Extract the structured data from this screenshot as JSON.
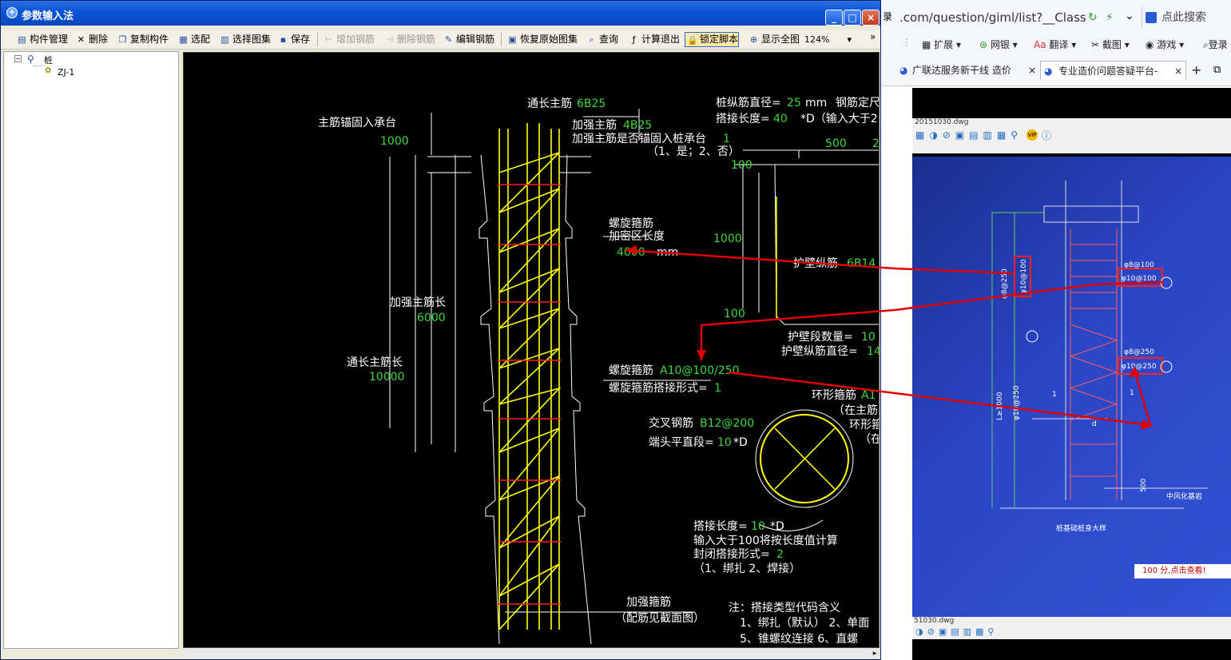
{
  "window": {
    "title": "参数输入法",
    "min_label": "_",
    "max_label": "□",
    "close_label": "×"
  },
  "toolbar": {
    "items": [
      {
        "label": "构件管理",
        "icon": "component-manage-icon",
        "enabled": true
      },
      {
        "label": "删除",
        "icon": "delete-icon",
        "enabled": true
      },
      {
        "label": "复制构件",
        "icon": "copy-icon",
        "enabled": true
      },
      {
        "label": "选配",
        "icon": "select-icon",
        "enabled": true
      },
      {
        "label": "选择图集",
        "icon": "atlas-icon",
        "enabled": true
      },
      {
        "label": "保存",
        "icon": "save-icon",
        "enabled": true
      },
      {
        "label": "增加钢筋",
        "icon": "add-rebar-icon",
        "enabled": false
      },
      {
        "label": "删除钢筋",
        "icon": "remove-rebar-icon",
        "enabled": false
      },
      {
        "label": "编辑钢筋",
        "icon": "edit-rebar-icon",
        "enabled": true
      },
      {
        "label": "恢复原始图集",
        "icon": "restore-icon",
        "enabled": true
      },
      {
        "label": "查询",
        "icon": "query-icon",
        "enabled": true
      },
      {
        "label": "计算退出",
        "icon": "calc-exit-icon",
        "enabled": true
      },
      {
        "label": "锁定脚本",
        "icon": "lock-icon",
        "enabled": true
      },
      {
        "label": "显示全图",
        "icon": "zoom-all-icon",
        "enabled": true
      }
    ],
    "zoom": "124%",
    "more": "»"
  },
  "tree": {
    "root": "桩",
    "child": "ZJ-1"
  },
  "cad": {
    "main_bar_label": "通长主筋",
    "main_bar_value": "6B25",
    "anchor_label": "主筋锚固入承台",
    "anchor_value": "1000",
    "reinf_bar_label": "加强主筋",
    "reinf_bar_value": "4B25",
    "reinf_anchor_q": "加强主筋是否锚固入桩承台",
    "reinf_anchor_value": "1",
    "reinf_anchor_opts": "（1、是；2、否）",
    "long_dia_label": "桩纵筋直径=",
    "long_dia_value": "25",
    "long_dia_unit": "mm",
    "fix_label": "钢筋定尺",
    "lap_label": "搭接长度=",
    "lap_value": "40",
    "lap_unit": "*D（输入大于2",
    "dim_500": "500",
    "dim_2": "2",
    "dim_100a": "100",
    "dim_1000": "1000",
    "dim_100b": "100",
    "spiral_dense_l1": "螺旋箍筋",
    "spiral_dense_l2": "加密区长度",
    "spiral_dense_value": "4000",
    "spiral_dense_unit": "mm",
    "wall_bar_label": "护壁纵筋",
    "wall_bar_value": "6B14",
    "reinf_len_label": "加强主筋长",
    "reinf_len_value": "6000",
    "main_len_label": "通长主筋长",
    "main_len_value": "10000",
    "wall_count_label": "护壁段数量=",
    "wall_count_value": "10",
    "wall_dia_label": "护壁纵筋直径=",
    "wall_dia_value": "14",
    "spiral_label": "螺旋箍筋",
    "spiral_value": "A10@100/250",
    "spiral_lap_label": "螺旋箍筋搭接形式=",
    "spiral_lap_value": "1",
    "ring_label": "环形箍筋",
    "ring_value": "A1",
    "ring_note1": "（在主筋外",
    "ring_label2": "环形箍",
    "ring_note2": "（在",
    "cross_label": "交叉钢筋",
    "cross_value": "B12@200",
    "end_label": "端头平直段=",
    "end_value": "10",
    "end_unit": "*D",
    "lap2_label": "搭接长度=",
    "lap2_value": "10",
    "lap2_unit": "*D",
    "lap2_note": "输入大于100将按长度值计算",
    "close_lap_label": "封闭搭接形式=",
    "close_lap_value": "2",
    "close_lap_opts": "（1、绑扎  2、焊接）",
    "stirrup_label": "加强箍筋",
    "stirrup_note": "（配筋见截面图）",
    "note_title": "注：搭接类型代码含义",
    "note_l1": "1、绑扎（默认）    2、单面",
    "note_l2": "5、锥螺纹连接    6、直螺"
  },
  "browser": {
    "url": ".com/question/giml/list?__ClassCod",
    "login_frag": "录",
    "search": "点此搜索",
    "bookmarks": [
      "扩展",
      "网银",
      "翻译",
      "截图",
      "游戏",
      "登录"
    ],
    "tabs": [
      "广联达服务新干线 造价",
      "专业造价问题答疑平台-",
      "+"
    ],
    "viewer_file": "20151030.dwg",
    "viewer_file2": "51030.dwg",
    "photo_labels": [
      "φ8@100",
      "φ10@100",
      "φ8@250",
      "φ10@250",
      "φ10@100",
      "φ10@250",
      "φ8@250",
      "L≥1000",
      "桩基础桩身大样",
      "1",
      "1",
      "d",
      "500",
      "中风化基岩"
    ],
    "bottom_text": "100 分,点击查看!"
  },
  "colors": {
    "accent": "#0a54d8",
    "cad_bg": "#000000",
    "cad_yellow": "#ffff00",
    "cad_red": "#ff2020",
    "cad_green": "#3bd93b",
    "arrow": "#e00000"
  }
}
